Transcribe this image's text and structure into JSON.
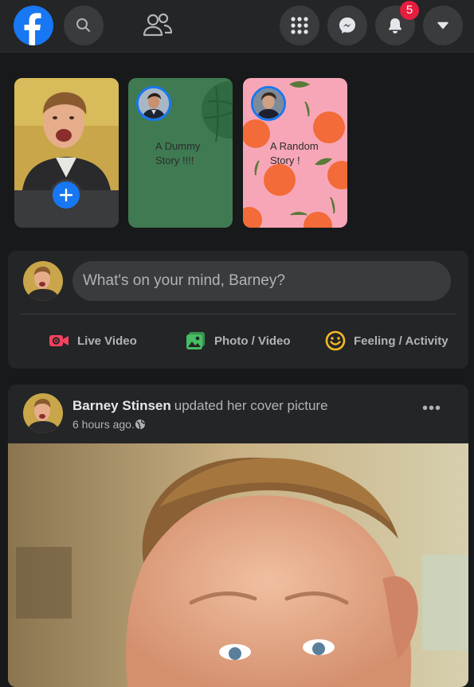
{
  "nav": {
    "notifications_count": "5",
    "icons": [
      "facebook-logo",
      "search-icon",
      "friends-icon",
      "menu-grid-icon",
      "messenger-icon",
      "bell-icon",
      "dropdown-icon"
    ]
  },
  "stories": [
    {
      "type": "create",
      "icon": "plus-icon"
    },
    {
      "type": "story",
      "text": "A Dummy Story !!!!",
      "bg": "#3f7a52"
    },
    {
      "type": "story",
      "text": "A Random Story !",
      "bg": "#f7a6b7"
    }
  ],
  "composer": {
    "placeholder": "What's on your mind, Barney?",
    "actions": [
      {
        "label": "Live Video",
        "icon": "live-video-icon",
        "color": "#f3425f"
      },
      {
        "label": "Photo / Video",
        "icon": "photo-icon",
        "color": "#45bd62"
      },
      {
        "label": "Feeling / Activity",
        "icon": "feeling-icon",
        "color": "#f7b928"
      }
    ]
  },
  "post": {
    "author": "Barney Stinsen",
    "action": "updated her cover picture",
    "time": "6 hours ago.",
    "more": "•••"
  },
  "colors": {
    "accent": "#1877f2",
    "background": "#18191a",
    "surface": "#242526",
    "badge": "#e41e3f"
  }
}
